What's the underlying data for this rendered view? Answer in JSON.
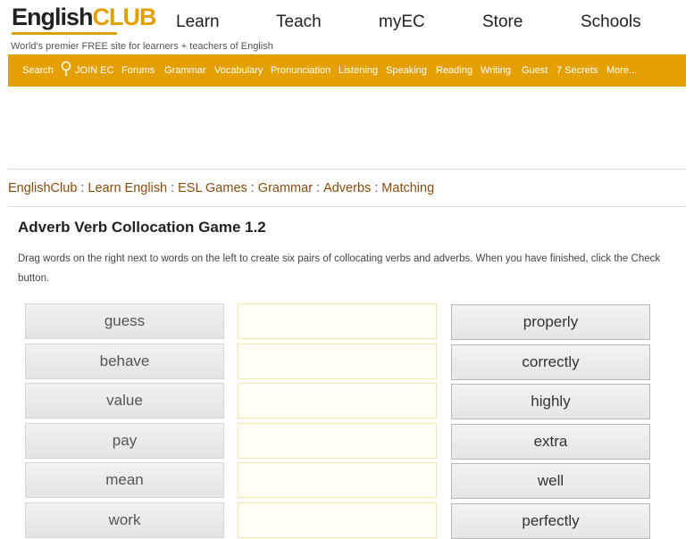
{
  "header": {
    "logo_part1": "English",
    "logo_part2": "CLUB",
    "tagline": "World's premier FREE site for learners + teachers of English",
    "nav": [
      "Learn",
      "Teach",
      "myEC",
      "Store",
      "Schools"
    ]
  },
  "menubar": {
    "search_label": "Search",
    "items": [
      "JOIN EC",
      "Forums",
      "Grammar",
      "Vocabulary",
      "Pronunciation",
      "Listening",
      "Speaking",
      "Reading",
      "Writing",
      "Guest",
      "7 Secrets",
      "More..."
    ]
  },
  "breadcrumb": {
    "items": [
      "EnglishClub",
      "Learn English",
      "ESL Games",
      "Grammar",
      "Adverbs",
      "Matching"
    ],
    "separator": ":"
  },
  "game": {
    "title": "Adverb Verb Collocation Game 1.2",
    "instructions": "Drag words on the right next to words on the left to create six pairs of collocating verbs and adverbs. When you have finished, click the Check button.",
    "verbs": [
      "guess",
      "behave",
      "value",
      "pay",
      "mean",
      "work"
    ],
    "adverbs": [
      "properly",
      "correctly",
      "highly",
      "extra",
      "well",
      "perfectly"
    ]
  },
  "colors": {
    "accent": "#e4a000",
    "link": "#8a4a0a"
  }
}
